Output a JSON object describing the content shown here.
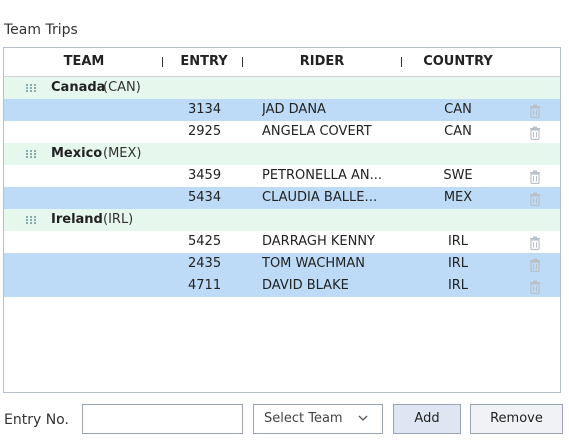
{
  "panel": {
    "title": "Team Trips"
  },
  "columns": [
    "TEAM",
    "ENTRY",
    "RIDER",
    "COUNTRY"
  ],
  "groups": [
    {
      "name": "Canada",
      "code": "(CAN)",
      "rows": [
        {
          "entry": "3134",
          "rider": "JAD DANA",
          "country": "CAN",
          "selected": true
        },
        {
          "entry": "2925",
          "rider": "ANGELA COVERT",
          "country": "CAN",
          "selected": false
        }
      ]
    },
    {
      "name": "Mexico",
      "code": "(MEX)",
      "rows": [
        {
          "entry": "3459",
          "rider": "PETRONELLA AN...",
          "country": "SWE",
          "selected": false
        },
        {
          "entry": "5434",
          "rider": "CLAUDIA BALLEST...",
          "country": "MEX",
          "selected": true
        }
      ]
    },
    {
      "name": "Ireland",
      "code": "(IRL)",
      "rows": [
        {
          "entry": "5425",
          "rider": "DARRAGH KENNY",
          "country": "IRL",
          "selected": false
        },
        {
          "entry": "2435",
          "rider": "TOM WACHMAN",
          "country": "IRL",
          "selected": true
        },
        {
          "entry": "4711",
          "rider": "DAVID BLAKE",
          "country": "IRL",
          "selected": true
        }
      ]
    }
  ],
  "footer": {
    "entry_label": "Entry No.",
    "entry_value": "",
    "select_value": "Select Team",
    "add_label": "Add",
    "remove_label": "Remove"
  },
  "colors": {
    "group_bg": "#e6f7ee",
    "selected_bg": "#bddbf7",
    "add_bg": "#dfe5f2"
  },
  "icons": {
    "row_action": "trash-icon",
    "group_handle": "drag-handle-icon",
    "select": "chevron-down-icon"
  }
}
